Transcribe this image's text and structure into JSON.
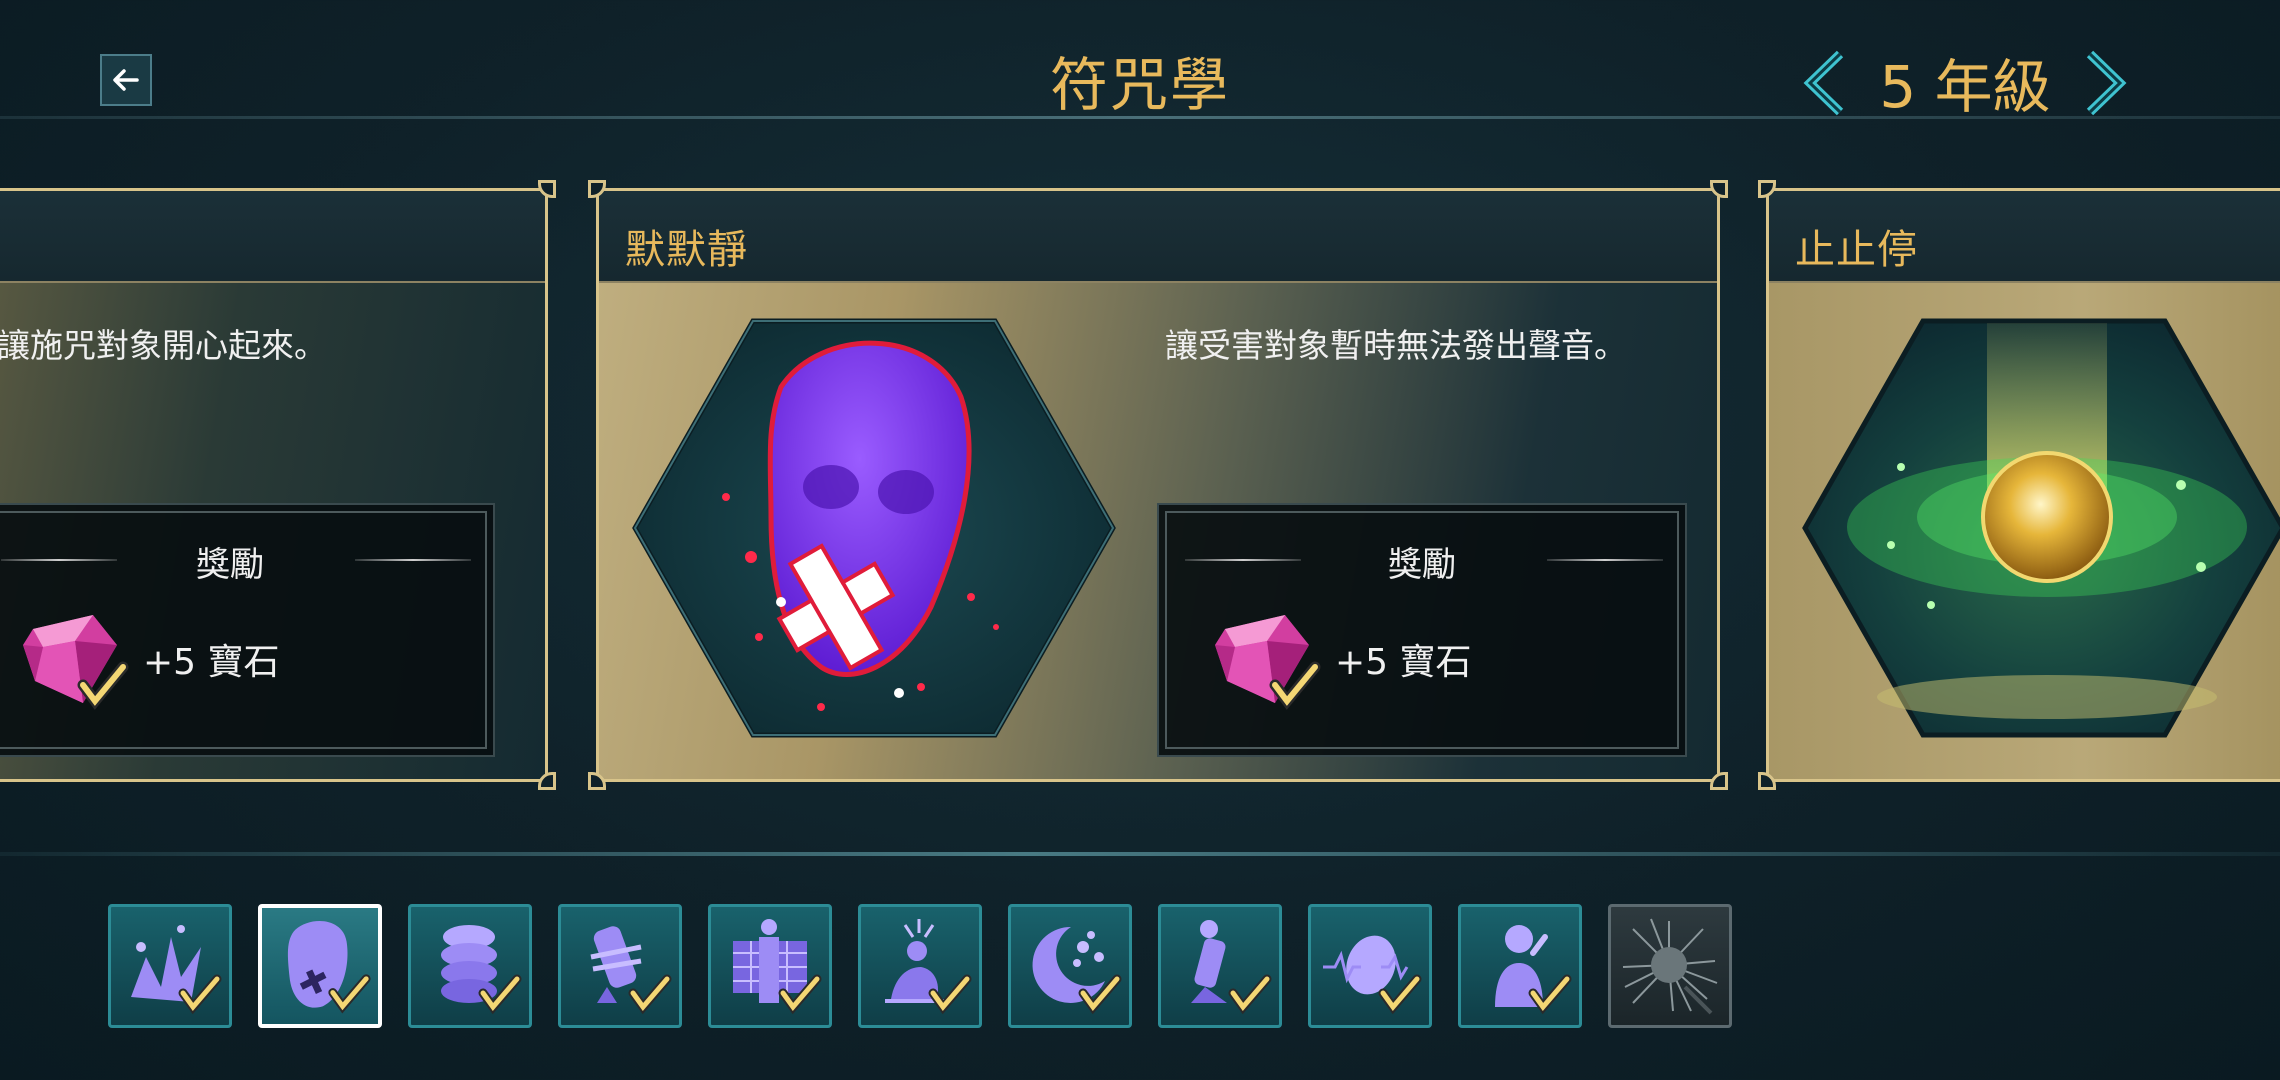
{
  "header": {
    "title": "符咒學",
    "year_label": "5 年級"
  },
  "cards": [
    {
      "name": "",
      "description": "讓施咒對象開心起來。",
      "reward_title": "獎勵",
      "reward_value": "+5 寶石",
      "reward_icon": "gem-icon"
    },
    {
      "name": "默默靜",
      "description": "讓受害對象暫時無法發出聲音。",
      "reward_title": "獎勵",
      "reward_value": "+5 寶石",
      "reward_icon": "gem-icon",
      "spell_icon": "silenced-face-icon"
    },
    {
      "name": "止止停",
      "spell_icon": "golden-orb-icon"
    }
  ],
  "spell_strip": [
    {
      "icon": "burst-spell-icon",
      "completed": true
    },
    {
      "icon": "silenced-face-icon",
      "completed": true,
      "selected": true
    },
    {
      "icon": "stacked-coins-icon",
      "completed": true
    },
    {
      "icon": "tied-figure-icon",
      "completed": true
    },
    {
      "icon": "figure-wall-icon",
      "completed": true
    },
    {
      "icon": "stunned-figure-icon",
      "completed": true
    },
    {
      "icon": "moon-rocks-icon",
      "completed": true
    },
    {
      "icon": "falling-figure-icon",
      "completed": true
    },
    {
      "icon": "orb-wave-icon",
      "completed": true
    },
    {
      "icon": "thinking-figure-icon",
      "completed": true
    },
    {
      "icon": "spiky-creature-icon",
      "completed": false,
      "locked": true
    }
  ],
  "colors": {
    "accent_gold": "#e8b95c",
    "card_border": "#d8c48a",
    "tile_border": "#2c8c96",
    "spell_purple": "#7a3cf0",
    "checkmark": "#f4d774"
  }
}
